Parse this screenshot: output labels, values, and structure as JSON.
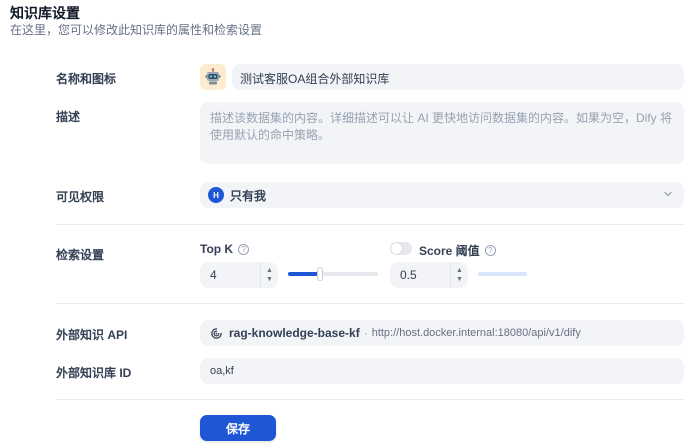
{
  "header": {
    "title": "知识库设置",
    "subtitle": "在这里，您可以修改此知识库的属性和检索设置"
  },
  "name": {
    "label": "名称和图标",
    "icon": "robot-icon",
    "value": "测试客服OA组合外部知识库"
  },
  "description": {
    "label": "描述",
    "placeholder": "描述该数据集的内容。详细描述可以让 AI 更快地访问数据集的内容。如果为空，Dify 将使用默认的命中策略。"
  },
  "permission": {
    "label": "可见权限",
    "avatar_initial": "H",
    "value": "只有我"
  },
  "retrieval": {
    "label": "检索设置",
    "top_k": {
      "label": "Top K",
      "value": "4",
      "slider_fraction": 0.35
    },
    "score": {
      "label": "Score 阈值",
      "enabled": false,
      "value": "0.5",
      "slider_fraction": 0.5
    }
  },
  "external_api": {
    "label": "外部知识 API",
    "name": "rag-knowledge-base-kf",
    "separator": "·",
    "url": "http://host.docker.internal:18080/api/v1/dify"
  },
  "external_id": {
    "label": "外部知识库 ID",
    "value": "oa,kf"
  },
  "save": {
    "label": "保存"
  },
  "colors": {
    "primary": "#1f56d6",
    "field_bg": "#f2f4f7",
    "icon_bg": "#fdeccf"
  }
}
